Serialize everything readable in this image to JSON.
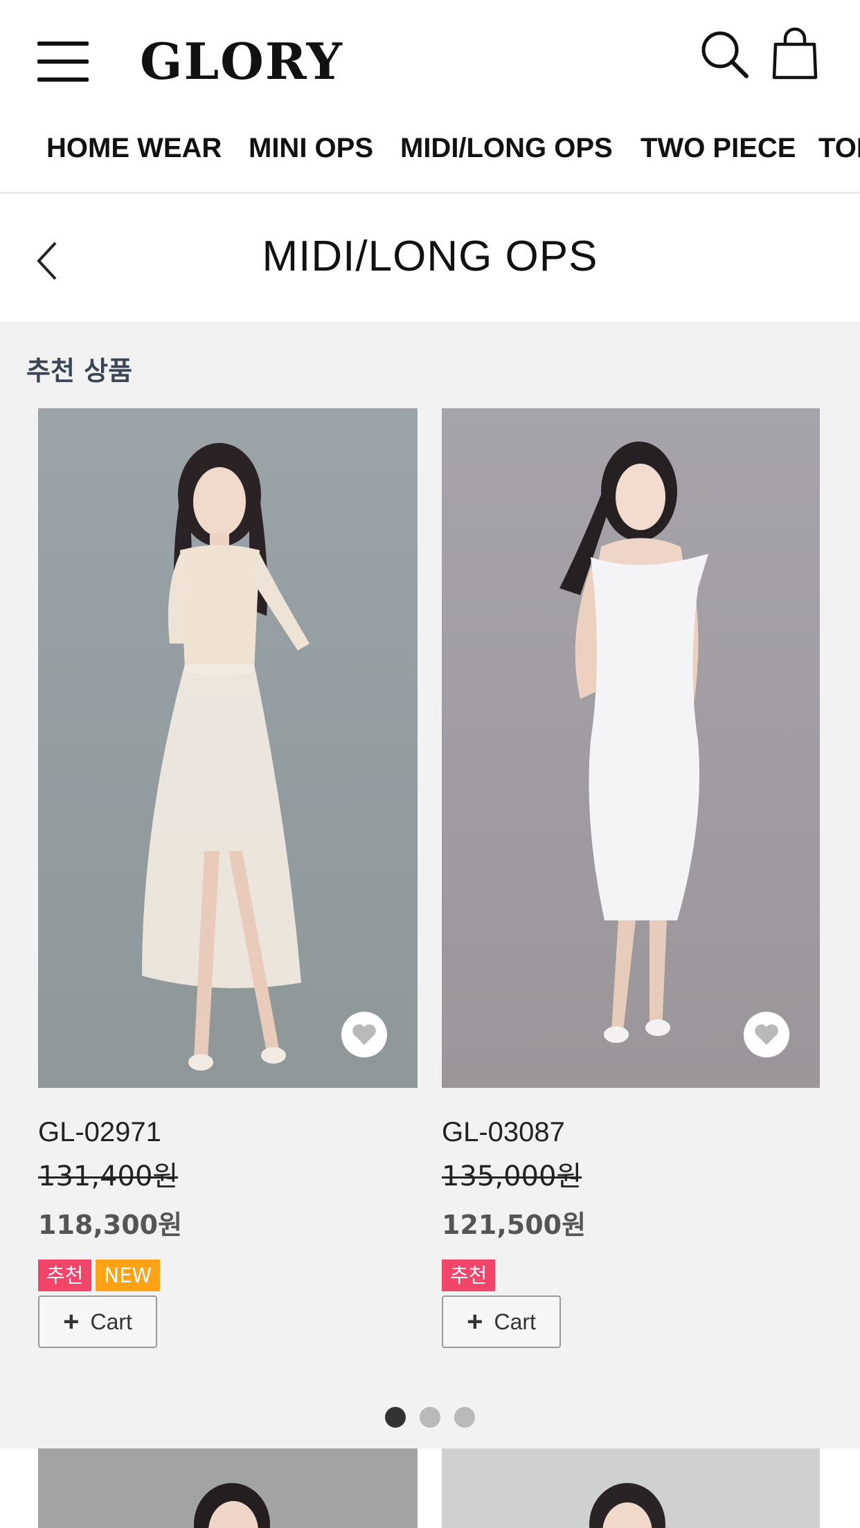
{
  "header": {
    "logo": "GLORY",
    "icons": [
      "hamburger-menu-icon",
      "search-icon",
      "shopping-bag-icon"
    ]
  },
  "categories": [
    "HOME WEAR",
    "MINI OPS",
    "MIDI/LONG OPS",
    "TWO PIECE",
    "TOP"
  ],
  "page": {
    "title": "MIDI/LONG OPS",
    "back_icon": "chevron-left-icon"
  },
  "recommended": {
    "heading": "추천 상품",
    "products": [
      {
        "code": "GL-02971",
        "original_price": "131,400원",
        "sale_price": "118,300원",
        "badges": [
          {
            "label": "추천",
            "color": "#f2456a"
          },
          {
            "label": "NEW",
            "color": "#ffa216"
          }
        ],
        "cart_label": "Cart",
        "image_bg": "#969fa3"
      },
      {
        "code": "GL-03087",
        "original_price": "135,000원",
        "sale_price": "121,500원",
        "badges": [
          {
            "label": "추천",
            "color": "#f2456a"
          }
        ],
        "cart_label": "Cart",
        "image_bg": "#a29ea4"
      }
    ],
    "pagination": {
      "total": 3,
      "active": 1
    }
  },
  "colors": {
    "accent_pink": "#f2456a",
    "accent_orange": "#ffa216",
    "section_bg": "#f2f2f2",
    "heading_color": "#3a4556"
  }
}
